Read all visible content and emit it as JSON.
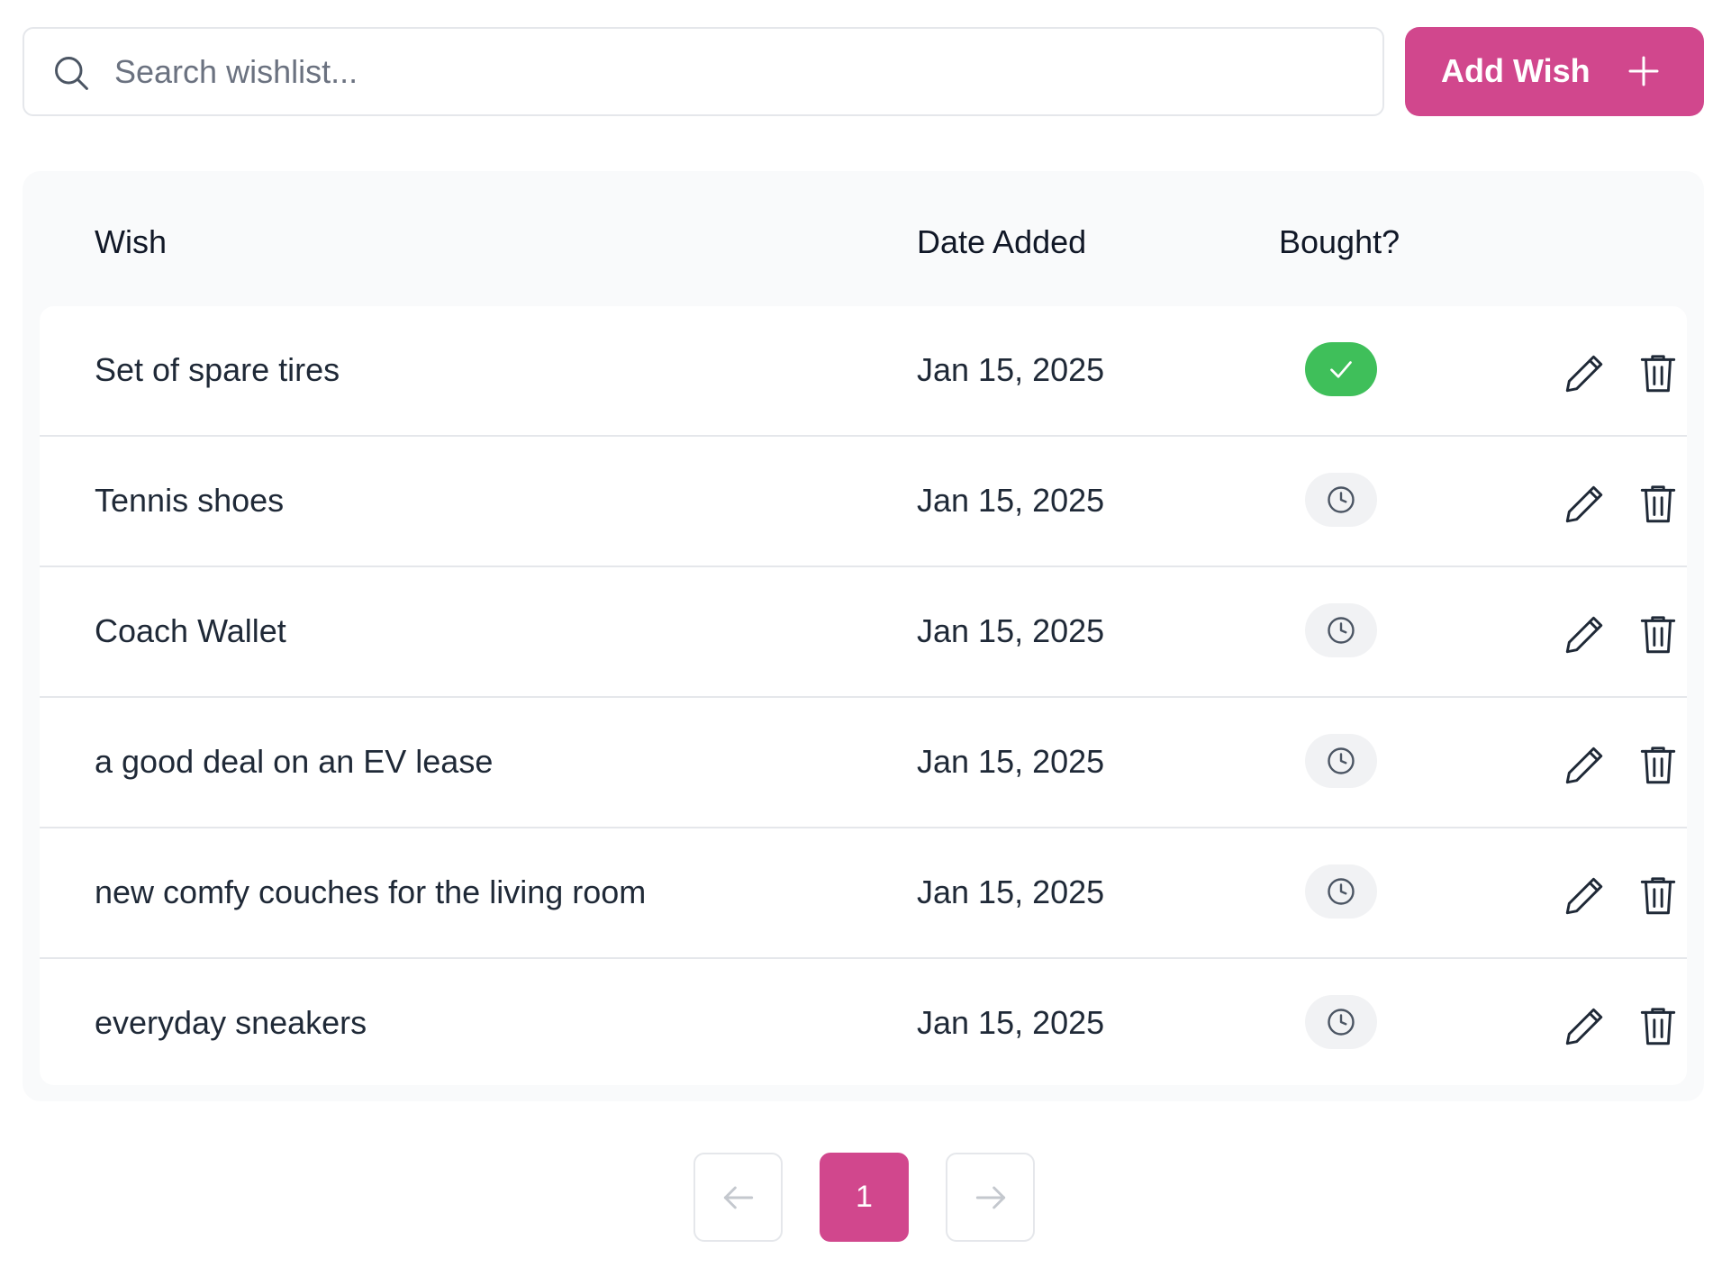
{
  "search": {
    "placeholder": "Search wishlist...",
    "value": ""
  },
  "toolbar": {
    "add_label": "Add Wish"
  },
  "table": {
    "headers": {
      "wish": "Wish",
      "date": "Date Added",
      "bought": "Bought?"
    },
    "rows": [
      {
        "wish": "Set of spare tires",
        "date": "Jan 15, 2025",
        "bought": true
      },
      {
        "wish": "Tennis shoes",
        "date": "Jan 15, 2025",
        "bought": false
      },
      {
        "wish": "Coach Wallet",
        "date": "Jan 15, 2025",
        "bought": false
      },
      {
        "wish": "a good deal on an EV lease",
        "date": "Jan 15, 2025",
        "bought": false
      },
      {
        "wish": "new comfy couches for the living room",
        "date": "Jan 15, 2025",
        "bought": false
      },
      {
        "wish": "everyday sneakers",
        "date": "Jan 15, 2025",
        "bought": false
      }
    ]
  },
  "pagination": {
    "current_page": "1"
  },
  "icons": {
    "search": "search-icon",
    "add": "plus-icon",
    "bought": "check-icon",
    "pending": "clock-icon",
    "edit": "pencil-icon",
    "delete": "trash-icon",
    "prev": "arrow-left-icon",
    "next": "arrow-right-icon"
  },
  "colors": {
    "accent": "#d1478d",
    "bought_green": "#3fbf5a",
    "pending_bg": "#f1f2f4",
    "card_bg": "#f9fafb",
    "border": "#e5e7eb"
  }
}
